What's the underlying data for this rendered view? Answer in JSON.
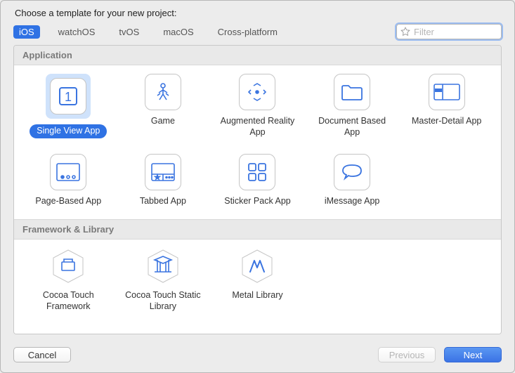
{
  "dialog": {
    "title": "Choose a template for your new project:"
  },
  "tabs": {
    "items": [
      "iOS",
      "watchOS",
      "tvOS",
      "macOS",
      "Cross-platform"
    ],
    "selected_index": 0
  },
  "search": {
    "placeholder": "Filter",
    "value": ""
  },
  "sections": [
    {
      "title": "Application",
      "items": [
        {
          "label": "Single View App",
          "icon": "single-view",
          "selected": true
        },
        {
          "label": "Game",
          "icon": "game",
          "selected": false
        },
        {
          "label": "Augmented Reality App",
          "icon": "ar",
          "selected": false
        },
        {
          "label": "Document Based App",
          "icon": "document",
          "selected": false
        },
        {
          "label": "Master-Detail App",
          "icon": "master-detail",
          "selected": false
        },
        {
          "label": "Page-Based App",
          "icon": "page-based",
          "selected": false
        },
        {
          "label": "Tabbed App",
          "icon": "tabbed",
          "selected": false
        },
        {
          "label": "Sticker Pack App",
          "icon": "sticker",
          "selected": false
        },
        {
          "label": "iMessage App",
          "icon": "imessage",
          "selected": false
        }
      ]
    },
    {
      "title": "Framework & Library",
      "items": [
        {
          "label": "Cocoa Touch Framework",
          "icon": "framework",
          "selected": false
        },
        {
          "label": "Cocoa Touch Static Library",
          "icon": "static-library",
          "selected": false
        },
        {
          "label": "Metal Library",
          "icon": "metal",
          "selected": false
        }
      ]
    }
  ],
  "buttons": {
    "cancel": "Cancel",
    "previous": "Previous",
    "next": "Next",
    "previous_enabled": false
  },
  "colors": {
    "accent": "#2f72e4",
    "icon_stroke": "#3a74e0"
  }
}
